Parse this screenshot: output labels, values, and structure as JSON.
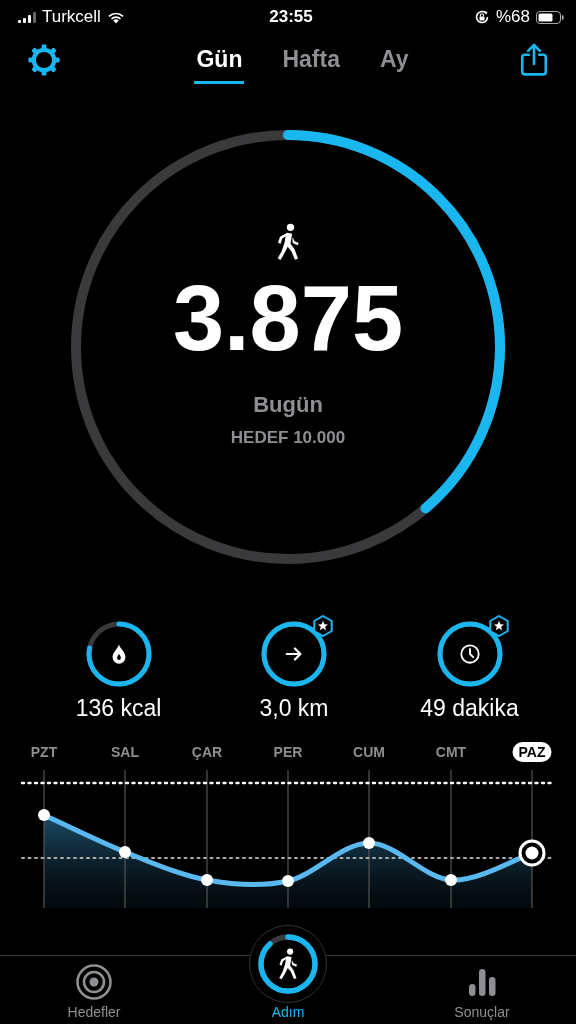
{
  "status_bar": {
    "carrier": "Turkcell",
    "time": "23:55",
    "battery": "%68"
  },
  "header": {
    "tabs": [
      {
        "label": "Gün",
        "selected": true
      },
      {
        "label": "Hafta",
        "selected": false
      },
      {
        "label": "Ay",
        "selected": false
      }
    ]
  },
  "steps": {
    "value": "3.875",
    "label": "Bugün",
    "goal": "HEDEF 10.000"
  },
  "stats": [
    {
      "kind": "calories",
      "value": "136 kcal",
      "badge": false
    },
    {
      "kind": "distance",
      "value": "3,0 km",
      "badge": true
    },
    {
      "kind": "duration",
      "value": "49 dakika",
      "badge": true
    }
  ],
  "chart": {
    "days": [
      {
        "label": "PZT",
        "selected": false
      },
      {
        "label": "SAL",
        "selected": false
      },
      {
        "label": "ÇAR",
        "selected": false
      },
      {
        "label": "PER",
        "selected": false
      },
      {
        "label": "CUM",
        "selected": false
      },
      {
        "label": "CMT",
        "selected": false
      },
      {
        "label": "PAZ",
        "selected": true
      }
    ]
  },
  "tab_bar": [
    {
      "kind": "goals",
      "label": "Hedefler",
      "selected": false
    },
    {
      "kind": "steps",
      "label": "Adım",
      "selected": true
    },
    {
      "kind": "results",
      "label": "Sonuçlar",
      "selected": false
    }
  ]
}
